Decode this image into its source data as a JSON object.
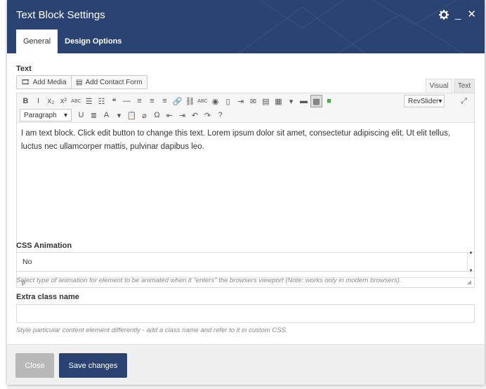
{
  "header": {
    "title": "Text Block Settings",
    "minimize_glyph": "_",
    "close_glyph": "✕",
    "bg_color": "#2b4372"
  },
  "tabs": [
    {
      "label": "General",
      "active": true
    },
    {
      "label": "Design Options",
      "active": false
    }
  ],
  "text_field": {
    "label": "Text",
    "add_media": "Add Media",
    "add_contact_form": "Add Contact Form",
    "mode_visual": "Visual",
    "mode_text": "Text",
    "toolbar": {
      "row1": [
        {
          "name": "bold-icon",
          "glyph": "B"
        },
        {
          "name": "italic-icon",
          "glyph": "I"
        },
        {
          "name": "subscript-icon",
          "glyph": "x₂"
        },
        {
          "name": "superscript-icon",
          "glyph": "x²"
        },
        {
          "name": "strikethrough-icon",
          "glyph": "ABC"
        },
        {
          "name": "bullet-list-icon",
          "glyph": "☰"
        },
        {
          "name": "numbered-list-icon",
          "glyph": "☷"
        },
        {
          "name": "blockquote-icon",
          "glyph": "❝"
        },
        {
          "name": "horizontal-rule-icon",
          "glyph": "—"
        },
        {
          "name": "align-left-icon",
          "glyph": "≡"
        },
        {
          "name": "align-center-icon",
          "glyph": "≡"
        },
        {
          "name": "align-right-icon",
          "glyph": "≡"
        },
        {
          "name": "link-icon",
          "glyph": "🔗"
        },
        {
          "name": "unlink-icon",
          "glyph": "⛓"
        },
        {
          "name": "spellcheck-icon",
          "glyph": "ABC"
        },
        {
          "name": "globe-icon",
          "glyph": "◉"
        },
        {
          "name": "bookmark-icon",
          "glyph": "▯"
        },
        {
          "name": "insert-more-icon",
          "glyph": "⇥"
        },
        {
          "name": "mail-icon",
          "glyph": "✉"
        },
        {
          "name": "paragraph-box-icon",
          "glyph": "▤"
        },
        {
          "name": "table-icon",
          "glyph": "▦"
        },
        {
          "name": "table-dropdown-icon",
          "glyph": "▾"
        },
        {
          "name": "page-break-icon",
          "glyph": "▬"
        },
        {
          "name": "toolbar-toggle-icon",
          "glyph": "▩"
        },
        {
          "name": "color-square-icon",
          "glyph": "■"
        }
      ],
      "revslider": "RevSlider",
      "fullscreen_glyph": "⤢",
      "paragraph_select": "Paragraph",
      "row2": [
        {
          "name": "underline-icon",
          "glyph": "U"
        },
        {
          "name": "justify-icon",
          "glyph": "≣"
        },
        {
          "name": "text-color-icon",
          "glyph": "A"
        },
        {
          "name": "text-color-dropdown-icon",
          "glyph": "▾"
        },
        {
          "name": "paste-text-icon",
          "glyph": "📋"
        },
        {
          "name": "clear-formatting-icon",
          "glyph": "⌀"
        },
        {
          "name": "special-char-icon",
          "glyph": "Ω"
        },
        {
          "name": "outdent-icon",
          "glyph": "⇤"
        },
        {
          "name": "indent-icon",
          "glyph": "⇥"
        },
        {
          "name": "undo-icon",
          "glyph": "↶"
        },
        {
          "name": "redo-icon",
          "glyph": "↷"
        },
        {
          "name": "help-icon",
          "glyph": "?"
        }
      ]
    },
    "content": "I am text block. Click edit button to change this text. Lorem ipsum dolor sit amet, consectetur adipiscing elit. Ut elit tellus, luctus nec ullamcorper mattis, pulvinar dapibus leo.",
    "status_path": "p"
  },
  "css_animation": {
    "label": "CSS Animation",
    "value": "No",
    "help": "Select type of animation for element to be animated when it \"enters\" the browsers viewport (Note: works only in modern browsers)."
  },
  "extra_class": {
    "label": "Extra class name",
    "value": "",
    "help": "Style particular content element differently - add a class name and refer to it in custom CSS."
  },
  "footer": {
    "close_label": "Close",
    "save_label": "Save changes"
  }
}
